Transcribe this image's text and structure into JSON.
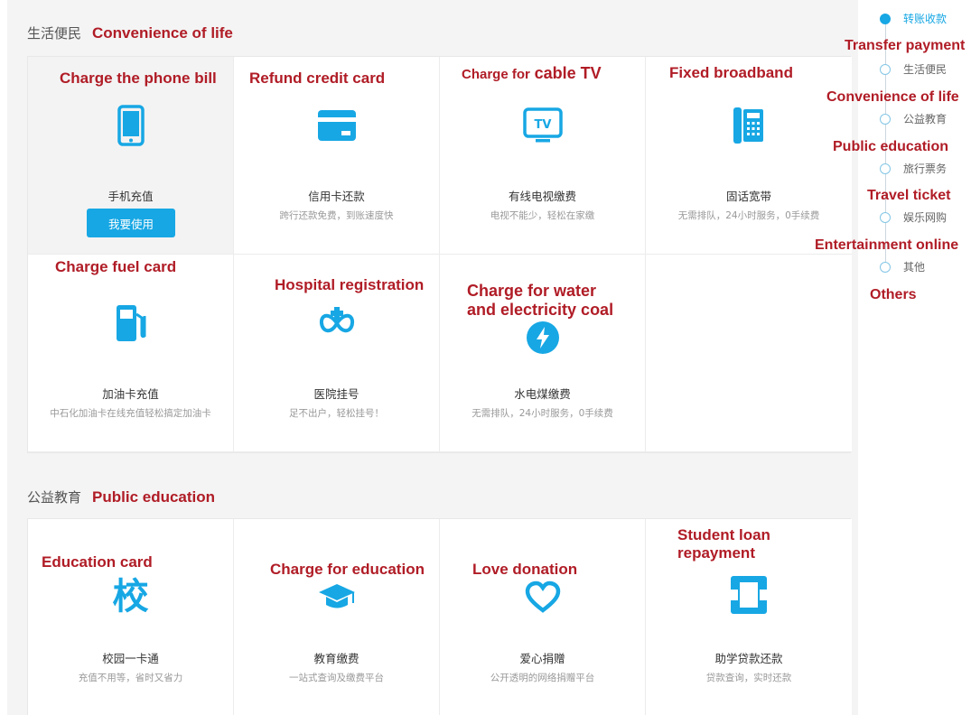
{
  "colors": {
    "accent": "#17a7e4",
    "annotation": "#b01c26",
    "panel": "#f4f4f4"
  },
  "section1": {
    "title": "生活便民",
    "annotation": "Convenience of life",
    "tiles": [
      {
        "name": "手机充值",
        "button": "我要使用",
        "annotation": "Charge the phone bill",
        "icon": "mobile-phone-icon"
      },
      {
        "name": "信用卡还款",
        "desc": "跨行还款免费，到账速度快",
        "annotation": "Refund credit card",
        "icon": "credit-card-icon"
      },
      {
        "name": "有线电视缴费",
        "desc": "电视不能少，轻松在家缴",
        "annotation_prefix": "Charge for",
        "annotation_main": "cable TV",
        "icon": "tv-icon",
        "icon_text": "TV"
      },
      {
        "name": "固话宽带",
        "desc": "无需排队，24小时服务，0手续费",
        "annotation": "Fixed broadband",
        "icon": "landline-phone-icon"
      },
      {
        "name": "加油卡充值",
        "desc": "中石化加油卡在线充值轻松搞定加油卡",
        "annotation": "Charge fuel card",
        "icon": "fuel-pump-icon"
      },
      {
        "name": "医院挂号",
        "desc": "足不出户，轻松挂号！",
        "annotation": "Hospital registration",
        "icon": "medical-cross-icon"
      },
      {
        "name": "水电煤缴费",
        "desc": "无需排队，24小时服务，0手续费",
        "annotation_line1": "Charge for water",
        "annotation_line2": "and electricity coal",
        "icon": "lightning-icon"
      }
    ]
  },
  "section2": {
    "title": "公益教育",
    "annotation": "Public education",
    "tiles": [
      {
        "name": "校园一卡通",
        "desc": "充值不用等，省时又省力",
        "annotation": "Education card",
        "icon": "school-character-icon",
        "icon_text": "校"
      },
      {
        "name": "教育缴费",
        "desc": "一站式查询及缴费平台",
        "annotation": "Charge for education",
        "icon": "graduation-cap-icon"
      },
      {
        "name": "爱心捐赠",
        "desc": "公开透明的网络捐赠平台",
        "annotation": "Love donation",
        "icon": "heart-icon"
      },
      {
        "name": "助学贷款还款",
        "desc": "贷款查询，实时还款",
        "annotation_line1": "Student loan",
        "annotation_line2": "repayment",
        "icon": "loan-card-icon"
      }
    ]
  },
  "sidenav": {
    "items": [
      {
        "label": "转账收款",
        "annotation": "Transfer payment"
      },
      {
        "label": "生活便民",
        "annotation": "Convenience of life"
      },
      {
        "label": "公益教育",
        "annotation": "Public education"
      },
      {
        "label": "旅行票务",
        "annotation": "Travel ticket"
      },
      {
        "label": "娱乐网购",
        "annotation": "Entertainment online"
      },
      {
        "label": "其他",
        "annotation": "Others"
      }
    ]
  }
}
